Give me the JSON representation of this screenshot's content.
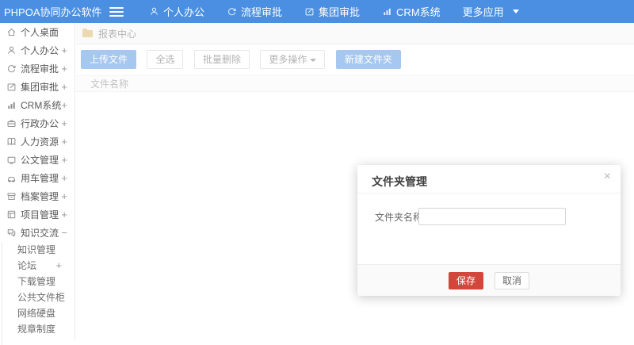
{
  "navbar": {
    "logo": "PHPOA协同办公软件",
    "items": [
      {
        "label": "个人办公",
        "icon": "user-icon"
      },
      {
        "label": "流程审批",
        "icon": "process-icon"
      },
      {
        "label": "集团审批",
        "icon": "edit-icon"
      },
      {
        "label": "CRM系统",
        "icon": "chart-icon"
      },
      {
        "label": "更多应用",
        "icon": "caret-down-icon"
      }
    ]
  },
  "sidebar": {
    "items": [
      {
        "label": "个人桌面",
        "icon": "home-icon",
        "toggle": ""
      },
      {
        "label": "个人办公",
        "icon": "user-icon",
        "toggle": "+"
      },
      {
        "label": "流程审批",
        "icon": "process-icon",
        "toggle": "+"
      },
      {
        "label": "集团审批",
        "icon": "edit-icon",
        "toggle": "+"
      },
      {
        "label": "CRM系统",
        "icon": "chart-icon",
        "toggle": "+"
      },
      {
        "label": "行政办公",
        "icon": "briefcase-icon",
        "toggle": "+"
      },
      {
        "label": "人力资源",
        "icon": "book-icon",
        "toggle": "+"
      },
      {
        "label": "公文管理",
        "icon": "document-icon",
        "toggle": "+"
      },
      {
        "label": "用车管理",
        "icon": "car-icon",
        "toggle": "+"
      },
      {
        "label": "档案管理",
        "icon": "archive-icon",
        "toggle": "+"
      },
      {
        "label": "项目管理",
        "icon": "project-icon",
        "toggle": "+"
      },
      {
        "label": "知识交流",
        "icon": "chat-icon",
        "toggle": "−"
      }
    ],
    "subitems": [
      {
        "label": "知识管理",
        "toggle": ""
      },
      {
        "label": "论坛",
        "toggle": "+"
      },
      {
        "label": "下载管理",
        "toggle": ""
      },
      {
        "label": "公共文件柜",
        "toggle": ""
      },
      {
        "label": "网络硬盘",
        "toggle": ""
      },
      {
        "label": "规章制度",
        "toggle": ""
      }
    ]
  },
  "breadcrumb": {
    "label": "报表中心"
  },
  "toolbar": {
    "upload": "上传文件",
    "select_all": "全选",
    "batch_delete": "批量删除",
    "more_actions": "更多操作",
    "new_folder": "新建文件夹"
  },
  "list": {
    "header_name": "文件名称"
  },
  "modal": {
    "title": "文件夹管理",
    "close": "×",
    "field_label": "文件夹名称",
    "input_value": "",
    "save": "保存",
    "cancel": "取消"
  },
  "colors": {
    "navbar_blue": "#4a8fe2",
    "primary_button_blue": "#a6c7ef",
    "save_red": "#d2463c",
    "folder_yellow": "#ecd9ad"
  }
}
